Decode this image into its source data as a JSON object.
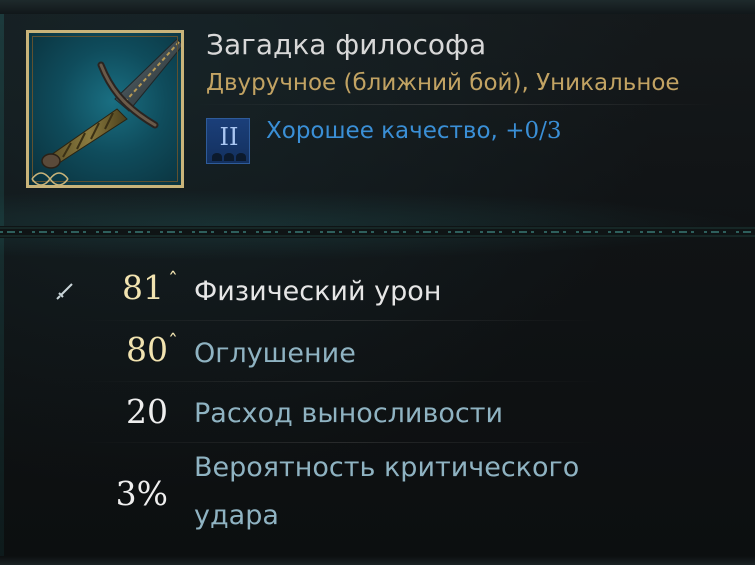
{
  "item": {
    "name": "Загадка философа",
    "type_line": "Двуручное (ближний бой), Уникальное",
    "tier_numeral": "II",
    "quality_text": "Хорошее качество, ",
    "quality_value": "+0/3",
    "icon": "sword-icon"
  },
  "stats": [
    {
      "value": "81",
      "label": "Физический урон",
      "upgraded": true,
      "icon": "sword-small-icon"
    },
    {
      "value": "80",
      "label": "Оглушение",
      "upgraded": true
    },
    {
      "value": "20",
      "label": "Расход выносливости",
      "upgraded": false
    },
    {
      "value": "3%",
      "label_line1": "Вероятность критического",
      "label_line2": "удара",
      "upgraded": false
    }
  ],
  "colors": {
    "gold_text": "#c2a363",
    "quality_blue": "#3a8fd6",
    "stat_label_blue": "#8fb3c2",
    "value_gold": "#f1e3b0",
    "frame_gold": "#c9b47a",
    "tier_badge": "#1b3f7a"
  }
}
